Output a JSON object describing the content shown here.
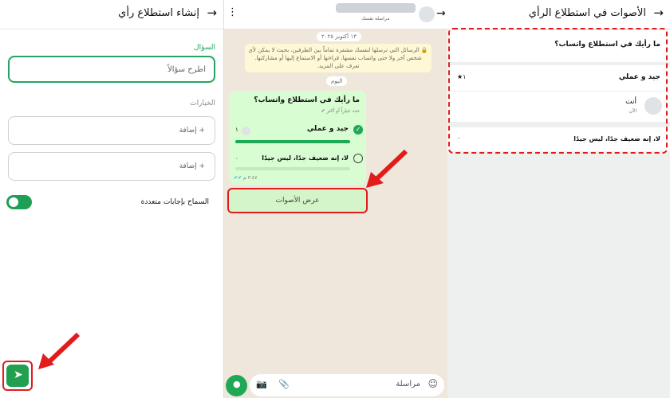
{
  "create_poll": {
    "title": "إنشاء استطلاع رأي",
    "question_label": "السؤال",
    "question_placeholder": "اطرح سؤالاً",
    "options_label": "الخيارات",
    "option_placeholder_1": "+ إضافة",
    "option_placeholder_2": "+ إضافة",
    "multi_answer_label": "السماح بإجابات متعددة",
    "multi_answer_on": true
  },
  "chat": {
    "contact_subtitle": "مراسلة نفسك",
    "date_chip": "١٣ أكتوبر ٢٠٢٥",
    "encryption_notice": "الرسائل التي ترسلها لنفسك مشفرة تماماً بين الطرفين، بحيث لا يمكن لأي شخص آخر ولا حتى واتساب نفسها، قراءتها أو الاستماع إليها أو مشاركتها. تعرف على المزيد.",
    "today_chip": "اليوم",
    "poll": {
      "question": "ما رأيك في استطلاع واتساب؟",
      "hint": "حدد خياراً أو أكثر",
      "options": [
        {
          "label": "جيد و عملي",
          "count": "١",
          "fraction": 1.0,
          "selected": true
        },
        {
          "label": "لا، إنه ضعيف جدًا، ليس جيدًا",
          "count": "٠",
          "fraction": 0.0,
          "selected": false
        }
      ],
      "time": "٣:٤٧ م"
    },
    "view_votes": "عرض الأصوات",
    "composer_placeholder": "مراسلة"
  },
  "votes": {
    "title": "الأصوات في استطلاع الرأي",
    "question": "ما رأيك في استطلاع واتساب؟",
    "option1": "جيد و عملي",
    "option1_count": "١",
    "voter_name": "أنت",
    "voter_time": "الآن",
    "option2": "لا، إنه ضعيف جدًا، ليس جيدًا",
    "option2_count": "٠"
  },
  "colors": {
    "accent": "#25d366",
    "highlight": "#e21b1b"
  }
}
